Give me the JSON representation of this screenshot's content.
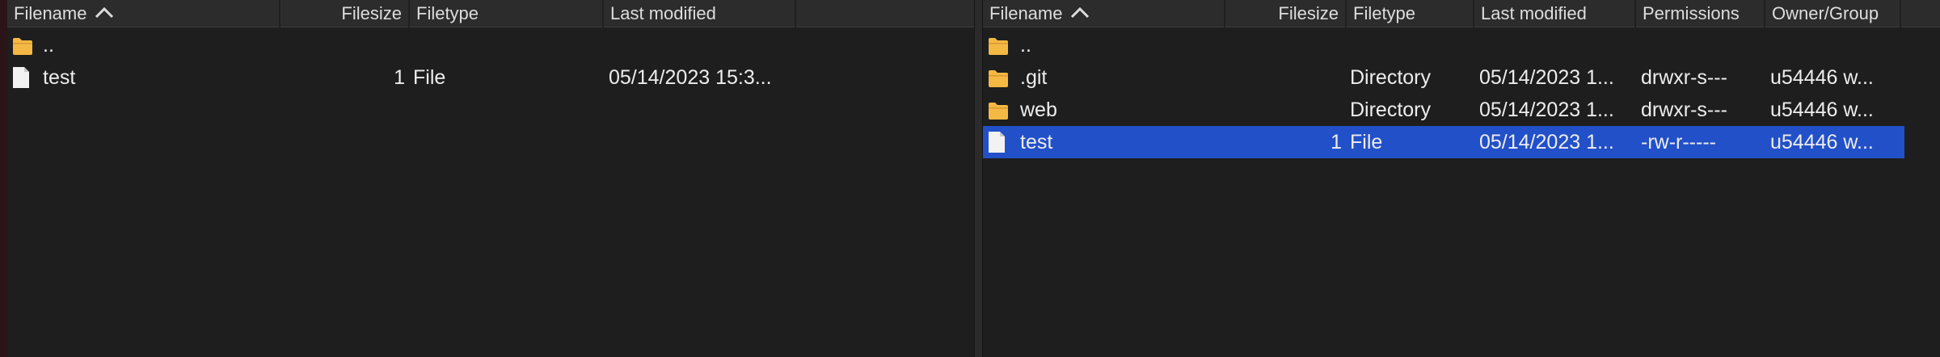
{
  "local": {
    "columns": {
      "filename": "Filename",
      "filesize": "Filesize",
      "filetype": "Filetype",
      "modified": "Last modified"
    },
    "rows": [
      {
        "name": "..",
        "size": "",
        "type": "",
        "modified": "",
        "icon": "folder-icon",
        "selected": false
      },
      {
        "name": "test",
        "size": "1",
        "type": "File",
        "modified": "05/14/2023 15:3...",
        "icon": "file-icon",
        "selected": false
      }
    ]
  },
  "remote": {
    "columns": {
      "filename": "Filename",
      "filesize": "Filesize",
      "filetype": "Filetype",
      "modified": "Last modified",
      "permissions": "Permissions",
      "owner": "Owner/Group"
    },
    "rows": [
      {
        "name": "..",
        "size": "",
        "type": "",
        "modified": "",
        "permissions": "",
        "owner": "",
        "icon": "folder-icon",
        "selected": false
      },
      {
        "name": ".git",
        "size": "",
        "type": "Directory",
        "modified": "05/14/2023 1...",
        "permissions": "drwxr-s---",
        "owner": "u54446 w...",
        "icon": "folder-icon",
        "selected": false
      },
      {
        "name": "web",
        "size": "",
        "type": "Directory",
        "modified": "05/14/2023 1...",
        "permissions": "drwxr-s---",
        "owner": "u54446 w...",
        "icon": "folder-icon",
        "selected": false
      },
      {
        "name": "test",
        "size": "1",
        "type": "File",
        "modified": "05/14/2023 1...",
        "permissions": "-rw-r-----",
        "owner": "u54446 w...",
        "icon": "file-icon",
        "selected": true
      }
    ]
  },
  "colors": {
    "background": "#1e1e1e",
    "header": "#2c2c2c",
    "selection": "#2250c9",
    "folder": "#f4b844",
    "file": "#f2f2f2"
  }
}
